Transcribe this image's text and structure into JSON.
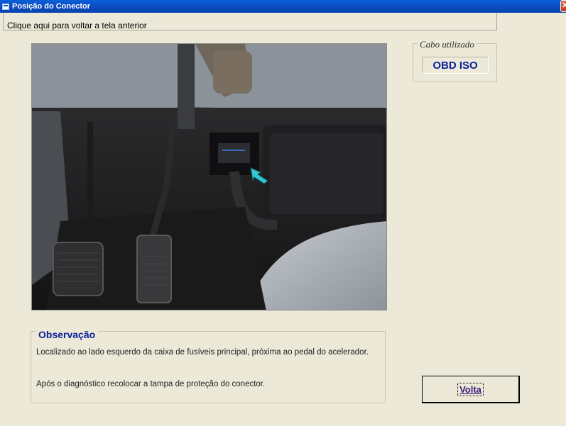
{
  "window": {
    "title": "Posição do Conector",
    "close_label": "✕"
  },
  "nav": {
    "back_link": "Clique aqui para voltar a tela anterior"
  },
  "cable": {
    "legend": "Cabo utilizado",
    "value": "OBD ISO"
  },
  "observation": {
    "legend": "Observação",
    "line1": "Localizado ao lado esquerdo da caixa de fusíveis principal, próxima ao pedal do acelerador.",
    "line2": "Após o diagnóstico recolocar a tampa de proteção do conector."
  },
  "actions": {
    "volta_label": "Volta"
  },
  "colors": {
    "titlebar": "#0b4fc4",
    "window_bg": "#ece9d8",
    "accent_text": "#0a1f9c"
  },
  "icons": [
    "app-icon",
    "close-icon",
    "arrow-icon"
  ]
}
